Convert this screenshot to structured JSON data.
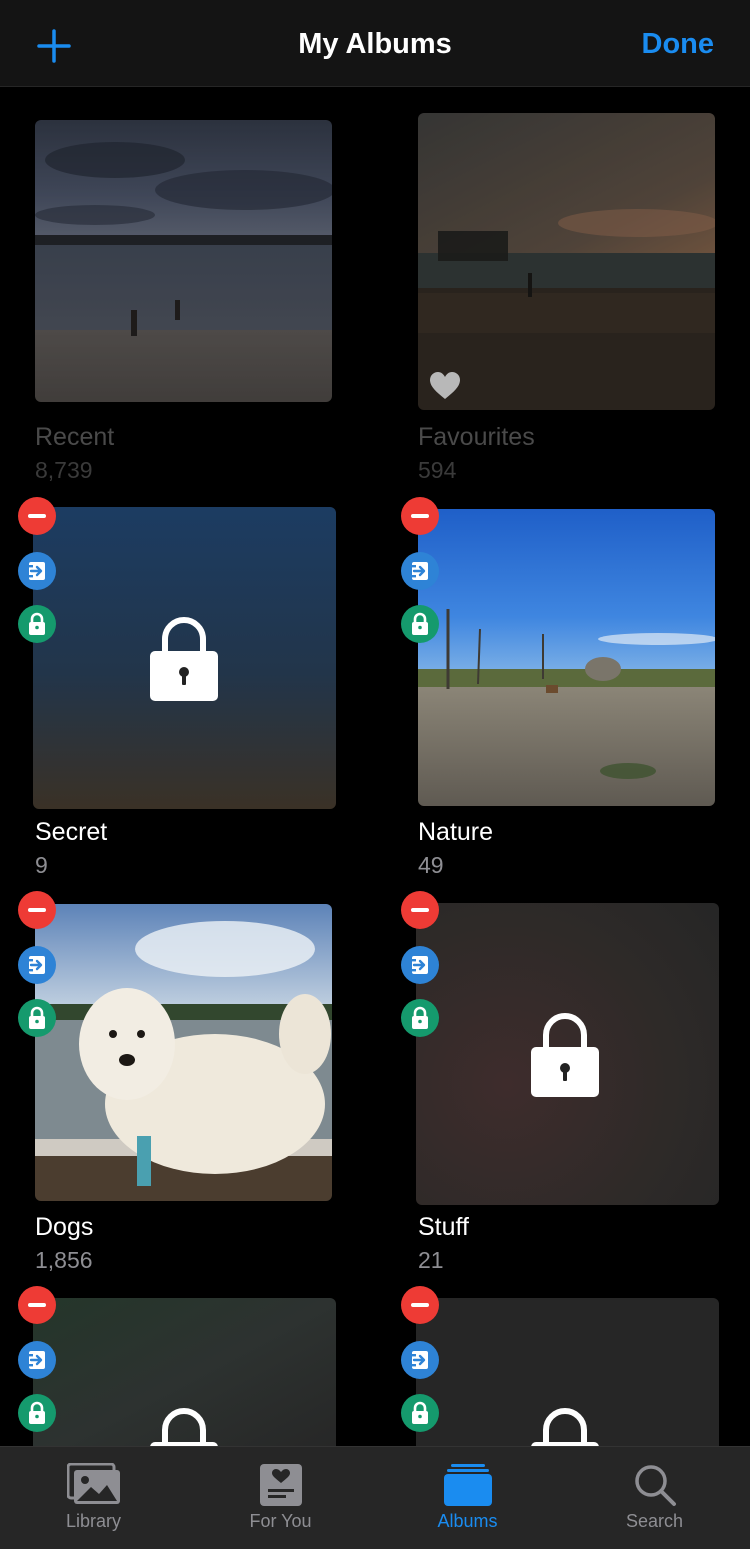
{
  "header": {
    "title": "My Albums",
    "done_label": "Done"
  },
  "albums": [
    {
      "name": "Recent",
      "count": "8,739"
    },
    {
      "name": "Favourites",
      "count": "594"
    },
    {
      "name": "Secret",
      "count": "9"
    },
    {
      "name": "Nature",
      "count": "49"
    },
    {
      "name": "Dogs",
      "count": "1,856"
    },
    {
      "name": "Stuff",
      "count": "21"
    }
  ],
  "tabbar": {
    "items": [
      {
        "label": "Library"
      },
      {
        "label": "For You"
      },
      {
        "label": "Albums"
      },
      {
        "label": "Search"
      }
    ],
    "active": "Albums"
  },
  "colors": {
    "accent": "#1a8cf0",
    "delete_badge": "#ee3b35",
    "move_badge": "#2e83d6",
    "lock_badge": "#159a6d"
  },
  "icons": [
    "plus-icon",
    "heart-icon",
    "lock-icon",
    "minus-icon",
    "move-icon",
    "library-icon",
    "for-you-icon",
    "albums-icon",
    "search-icon"
  ]
}
